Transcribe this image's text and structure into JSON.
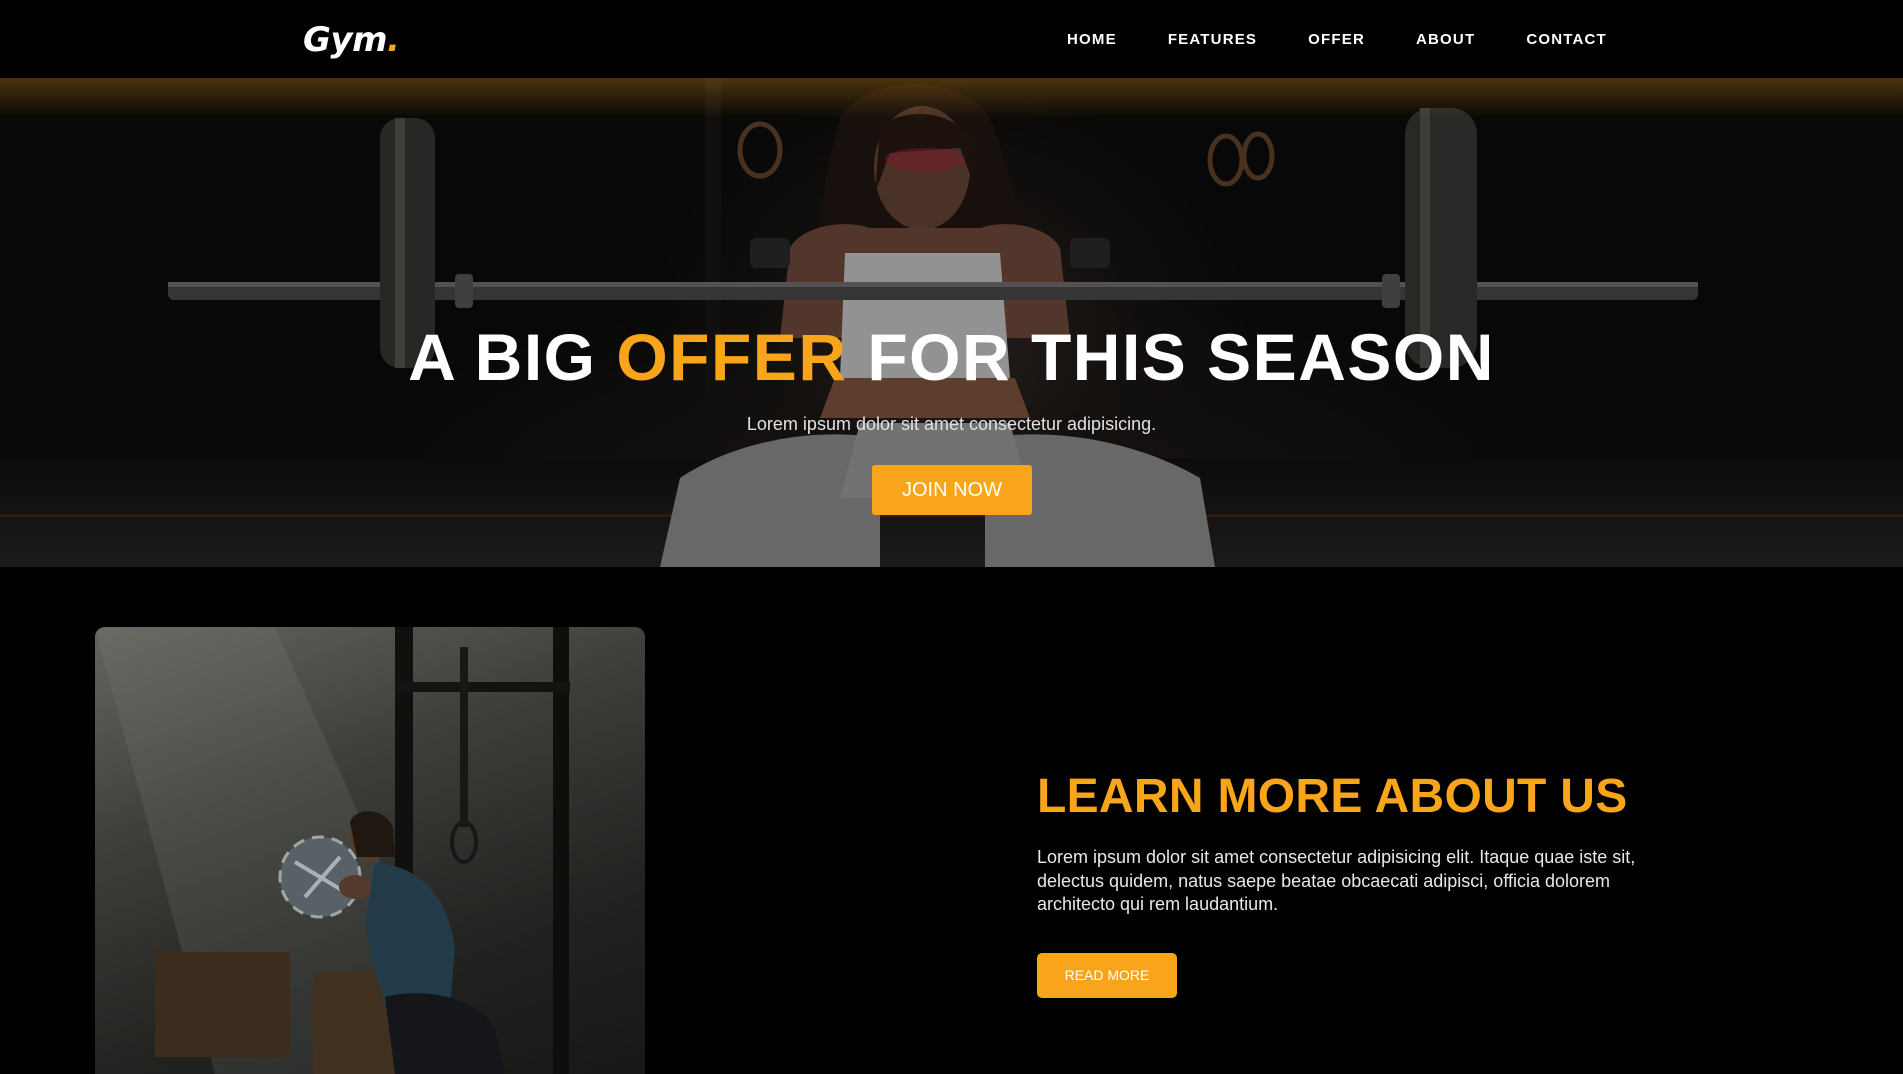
{
  "brand": {
    "name": "Gym",
    "dot": ".",
    "accent_color": "#f9a51b"
  },
  "nav": {
    "items": [
      {
        "label": "HOME"
      },
      {
        "label": "FEATURES"
      },
      {
        "label": "OFFER"
      },
      {
        "label": "ABOUT"
      },
      {
        "label": "CONTACT"
      }
    ]
  },
  "hero": {
    "title_part1": "A BIG ",
    "title_accent": "OFFER",
    "title_part2": " FOR THIS SEASON",
    "subtitle": "Lorem ipsum dolor sit amet consectetur adipisicing.",
    "button_label": "JOIN NOW",
    "image_subject": "woman-lifting-barbell-photo"
  },
  "about": {
    "title": "LEARN MORE ABOUT US",
    "text": "Lorem ipsum dolor sit amet consectetur adipisicing elit. Itaque quae iste sit, delectus quidem, natus saepe beatae obcaecati adipisci, officia dolorem architecto qui rem laudantium.",
    "button_label": "READ MORE",
    "image_subject": "woman-holding-medicine-ball-photo"
  },
  "colors": {
    "background": "#000000",
    "accent": "#f9a51b",
    "text": "#ffffff"
  }
}
